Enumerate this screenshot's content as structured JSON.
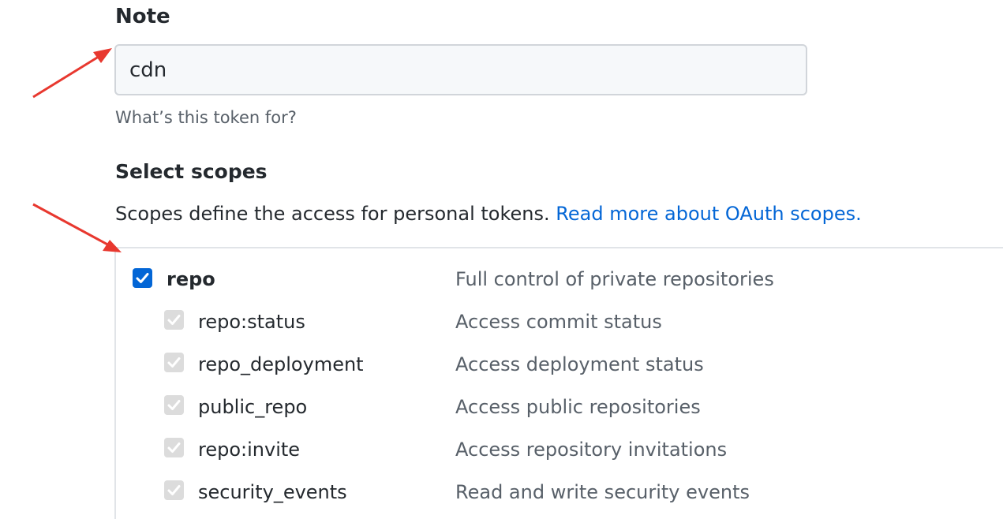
{
  "note": {
    "label": "Note",
    "value": "cdn",
    "hint": "What’s this token for?"
  },
  "scopes": {
    "heading": "Select scopes",
    "description": "Scopes define the access for personal tokens. ",
    "link_text": "Read more about OAuth scopes.",
    "items": [
      {
        "name": "repo",
        "description": "Full control of private repositories",
        "checked": true,
        "parent": true
      },
      {
        "name": "repo:status",
        "description": "Access commit status",
        "checked": true,
        "parent": false
      },
      {
        "name": "repo_deployment",
        "description": "Access deployment status",
        "checked": true,
        "parent": false
      },
      {
        "name": "public_repo",
        "description": "Access public repositories",
        "checked": true,
        "parent": false
      },
      {
        "name": "repo:invite",
        "description": "Access repository invitations",
        "checked": true,
        "parent": false
      },
      {
        "name": "security_events",
        "description": "Read and write security events",
        "checked": true,
        "parent": false
      }
    ]
  },
  "colors": {
    "link": "#0366d6",
    "checkbox_checked": "#0366d6",
    "checkbox_disabled": "#dcdcdc",
    "annotation_arrow": "#e8382f"
  },
  "icons": {
    "checkmark": "check-icon",
    "annotation": "red-arrow-icon"
  }
}
